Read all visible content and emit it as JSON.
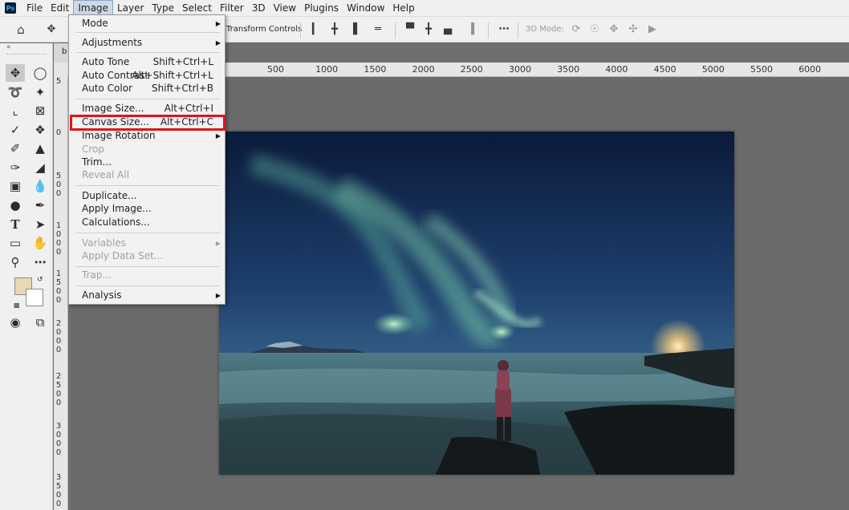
{
  "menubar": {
    "logo": "Ps",
    "items": [
      "File",
      "Edit",
      "Image",
      "Layer",
      "Type",
      "Select",
      "Filter",
      "3D",
      "View",
      "Plugins",
      "Window",
      "Help"
    ],
    "active_index": 2
  },
  "options_bar": {
    "home_icon": "home-icon",
    "move_icon": "move-tool-icon",
    "transform_controls": "Transform Controls",
    "mode3d": "3D Mode:"
  },
  "document": {
    "tab_label": "b"
  },
  "rulers": {
    "horizontal": [
      "500",
      "1000",
      "1500",
      "2000",
      "2500",
      "3000",
      "3500",
      "4000",
      "4500",
      "5000",
      "5500",
      "6000"
    ],
    "vertical": [
      "5",
      "0",
      "500",
      "1000",
      "1500",
      "2000",
      "2500",
      "3000",
      "3500"
    ]
  },
  "colors": {
    "foreground": "#e8d9b3",
    "background": "#ffffff",
    "highlight": "#e0141b"
  },
  "image_menu": {
    "items": [
      {
        "label": "Mode",
        "shortcut": "",
        "submenu": true,
        "disabled": false
      },
      {
        "label": "Adjustments",
        "shortcut": "",
        "submenu": true,
        "disabled": false
      },
      {
        "label": "Auto Tone",
        "shortcut": "Shift+Ctrl+L",
        "submenu": false,
        "disabled": false
      },
      {
        "label": "Auto Contrast",
        "shortcut": "Alt+Shift+Ctrl+L",
        "submenu": false,
        "disabled": false
      },
      {
        "label": "Auto Color",
        "shortcut": "Shift+Ctrl+B",
        "submenu": false,
        "disabled": false
      },
      {
        "label": "Image Size...",
        "shortcut": "Alt+Ctrl+I",
        "submenu": false,
        "disabled": false
      },
      {
        "label": "Canvas Size...",
        "shortcut": "Alt+Ctrl+C",
        "submenu": false,
        "disabled": false
      },
      {
        "label": "Image Rotation",
        "shortcut": "",
        "submenu": true,
        "disabled": false
      },
      {
        "label": "Crop",
        "shortcut": "",
        "submenu": false,
        "disabled": true
      },
      {
        "label": "Trim...",
        "shortcut": "",
        "submenu": false,
        "disabled": false
      },
      {
        "label": "Reveal All",
        "shortcut": "",
        "submenu": false,
        "disabled": true
      },
      {
        "label": "Duplicate...",
        "shortcut": "",
        "submenu": false,
        "disabled": false
      },
      {
        "label": "Apply Image...",
        "shortcut": "",
        "submenu": false,
        "disabled": false
      },
      {
        "label": "Calculations...",
        "shortcut": "",
        "submenu": false,
        "disabled": false
      },
      {
        "label": "Variables",
        "shortcut": "",
        "submenu": true,
        "disabled": true
      },
      {
        "label": "Apply Data Set...",
        "shortcut": "",
        "submenu": false,
        "disabled": true
      },
      {
        "label": "Trap...",
        "shortcut": "",
        "submenu": false,
        "disabled": true
      },
      {
        "label": "Analysis",
        "shortcut": "",
        "submenu": true,
        "disabled": false
      }
    ],
    "highlighted_item": "Canvas Size..."
  }
}
